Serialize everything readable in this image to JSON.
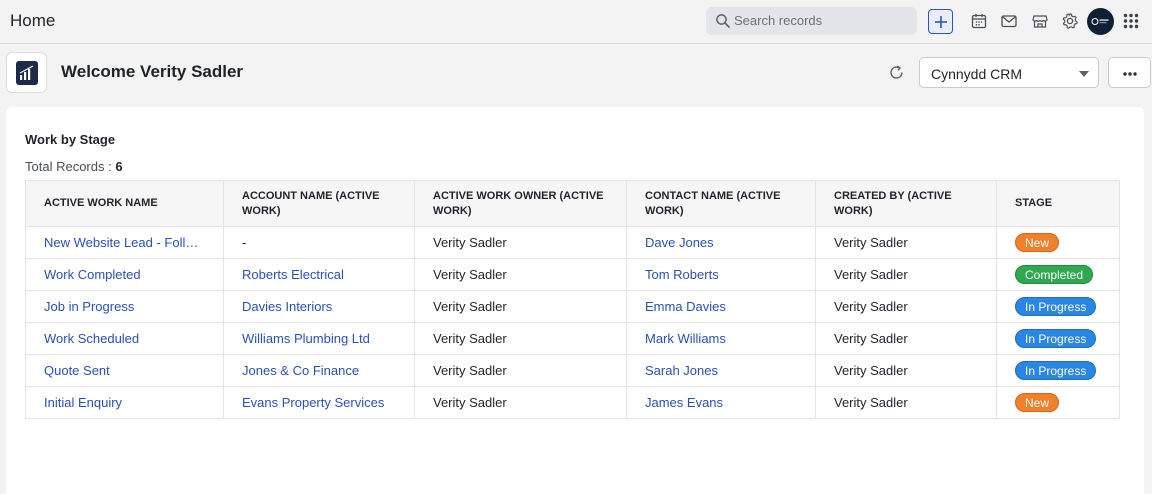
{
  "header": {
    "title": "Home",
    "search_placeholder": "Search records",
    "icons": [
      "add-icon",
      "calendar-icon",
      "mail-icon",
      "store-icon",
      "gear-icon",
      "avatar",
      "apps-grid-icon"
    ]
  },
  "welcome": {
    "text": "Welcome Verity Sadler",
    "crm_select": "Cynnydd CRM"
  },
  "card": {
    "title": "Work by Stage",
    "total_label": "Total Records :",
    "total_value": "6",
    "columns": [
      "ACTIVE WORK NAME",
      "ACCOUNT NAME (ACTIVE WORK)",
      "ACTIVE WORK OWNER (ACTIVE WORK)",
      "CONTACT NAME (ACTIVE WORK)",
      "CREATED BY (ACTIVE WORK)",
      "STAGE"
    ],
    "rows": [
      {
        "name": "New Website Lead - Follow up",
        "account": "-",
        "owner": "Verity Sadler",
        "contact": "Dave Jones",
        "created_by": "Verity Sadler",
        "stage": "New"
      },
      {
        "name": "Work Completed",
        "account": "Roberts Electrical",
        "owner": "Verity Sadler",
        "contact": "Tom Roberts",
        "created_by": "Verity Sadler",
        "stage": "Completed"
      },
      {
        "name": "Job in Progress",
        "account": "Davies Interiors",
        "owner": "Verity Sadler",
        "contact": "Emma Davies",
        "created_by": "Verity Sadler",
        "stage": "In Progress"
      },
      {
        "name": "Work Scheduled",
        "account": "Williams Plumbing Ltd",
        "owner": "Verity Sadler",
        "contact": "Mark Williams",
        "created_by": "Verity Sadler",
        "stage": "In Progress"
      },
      {
        "name": "Quote Sent",
        "account": "Jones & Co Finance",
        "owner": "Verity Sadler",
        "contact": "Sarah Jones",
        "created_by": "Verity Sadler",
        "stage": "In Progress"
      },
      {
        "name": "Initial Enquiry",
        "account": "Evans Property Services",
        "owner": "Verity Sadler",
        "contact": "James Evans",
        "created_by": "Verity Sadler",
        "stage": "New"
      }
    ]
  },
  "colors": {
    "link": "#2b4fb8",
    "new": "#f0802a",
    "completed": "#2fa84f",
    "in_progress": "#2a86e0"
  }
}
